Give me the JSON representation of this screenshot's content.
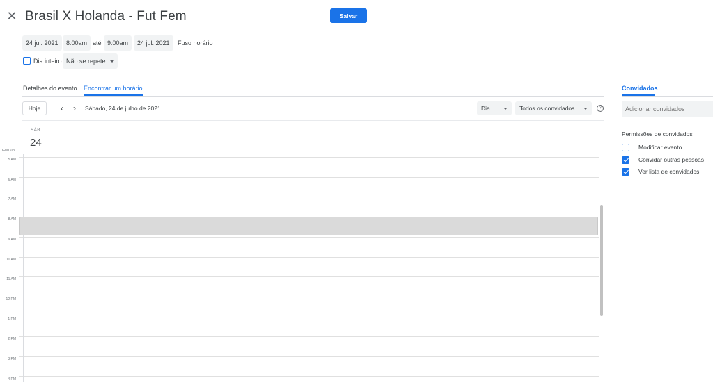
{
  "header": {
    "close_icon": "close-icon",
    "title": "Brasil X Holanda - Fut Fem",
    "save_label": "Salvar"
  },
  "datetime": {
    "start_date": "24 jul. 2021",
    "start_time": "8:00am",
    "until": "até",
    "end_time": "9:00am",
    "end_date": "24 jul. 2021",
    "timezone": "Fuso horário"
  },
  "allday": {
    "label": "Dia inteiro",
    "checked": false,
    "repeat": "Não se repete"
  },
  "tabs": {
    "details": "Detalhes do evento",
    "find_time": "Encontrar um horário",
    "active": "find_time"
  },
  "toolbar": {
    "today": "Hoje",
    "prev_icon": "chevron-left-icon",
    "next_icon": "chevron-right-icon",
    "date_label": "Sábado, 24 de julho de 2021",
    "view": "Dia",
    "guests_filter": "Todos os convidados",
    "help_icon": "help-icon"
  },
  "day": {
    "dow": "SÁB.",
    "num": "24",
    "tz": "GMT-03"
  },
  "hours": [
    "5 AM",
    "6 AM",
    "7 AM",
    "8 AM",
    "9 AM",
    "10 AM",
    "11 AM",
    "12 PM",
    "1 PM",
    "2 PM",
    "3 PM",
    "4 PM"
  ],
  "guests": {
    "tab": "Convidados",
    "add_placeholder": "Adicionar convidados",
    "permissions_title": "Permissões de convidados",
    "permissions": [
      {
        "label": "Modificar evento",
        "checked": false
      },
      {
        "label": "Convidar outras pessoas",
        "checked": true
      },
      {
        "label": "Ver lista de convidados",
        "checked": true
      }
    ]
  },
  "colors": {
    "accent": "#1a73e8",
    "event_block": "#dadada"
  }
}
